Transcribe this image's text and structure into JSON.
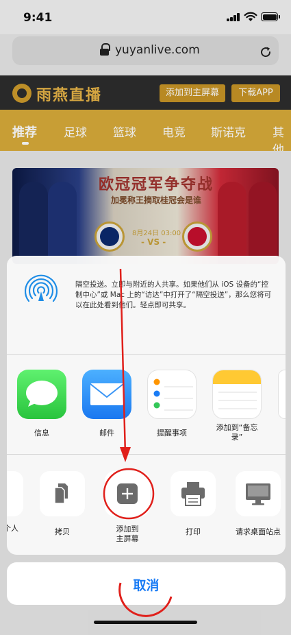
{
  "status": {
    "time": "9:41"
  },
  "browser": {
    "url": "yuyanlive.com"
  },
  "site": {
    "brand": "雨燕直播",
    "add_to_home_button": "添加到主屏幕",
    "download_button": "下载APP",
    "nav": [
      "推荐",
      "足球",
      "篮球",
      "电竞",
      "斯诺克",
      "其他"
    ]
  },
  "banner": {
    "title": "欧冠冠军争夺战",
    "subtitle": "加冕称王摘取桂冠会是谁",
    "date": "8月24日 03:00",
    "vs": "- VS -"
  },
  "share": {
    "airdrop_text": "隔空投送。立即与附近的人共享。如果他们从 iOS 设备的“控制中心”或 Mac 上的“访达”中打开了“隔空投送”，那么您将可以在此处看到他们。轻点即可共享。",
    "apps": {
      "messages": "信息",
      "mail": "邮件",
      "reminders": "提醒事项",
      "notes_line1": "添加到“备忘",
      "notes_line2": "录”"
    },
    "actions": {
      "people": "个人",
      "copy": "拷贝",
      "add_home_line1": "添加到",
      "add_home_line2": "主屏幕",
      "print": "打印",
      "desktop_site": "请求桌面站点"
    },
    "cancel": "取消"
  },
  "colors": {
    "gold": "#d9ac3a",
    "dark_header": "#2d2d2d",
    "ios_blue": "#1a7cf5",
    "annotation_red": "#e0201b"
  }
}
